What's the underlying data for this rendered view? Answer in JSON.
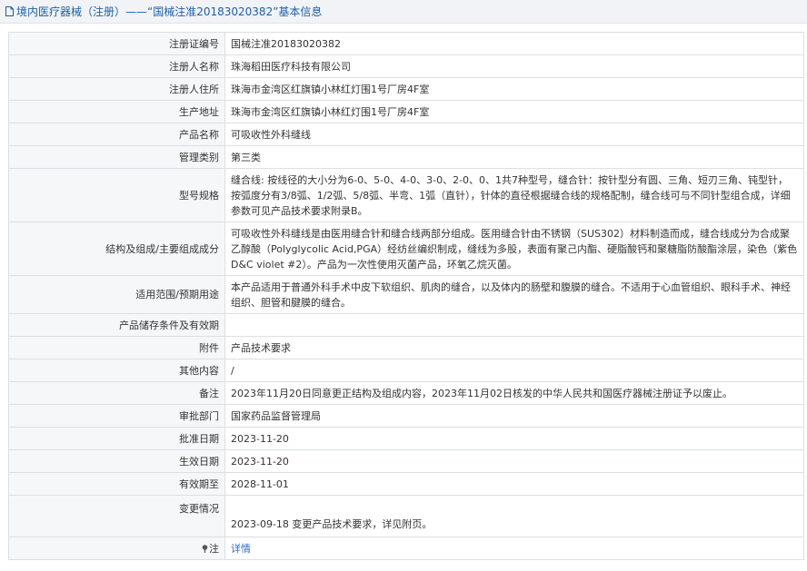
{
  "header": {
    "title": "境内医疗器械（注册）——“国械注准20183020382”基本信息"
  },
  "rows": [
    {
      "label": "注册证编号",
      "value": "国械注准20183020382"
    },
    {
      "label": "注册人名称",
      "value": "珠海稻田医疗科技有限公司"
    },
    {
      "label": "注册人住所",
      "value": "珠海市金湾区红旗镇小林红灯围1号厂房4F室"
    },
    {
      "label": "生产地址",
      "value": "珠海市金湾区红旗镇小林红灯围1号厂房4F室"
    },
    {
      "label": "产品名称",
      "value": "可吸收性外科缝线"
    },
    {
      "label": "管理类别",
      "value": "第三类"
    },
    {
      "label": "型号规格",
      "value": "缝合线: 按线径的大小分为6-0、5-0、4-0、3-0、2-0、0、1共7种型号，缝合针：按针型分有圆、三角、短刃三角、钝型针，按弧度分有3/8弧、1/2弧、5/8弧、半弯、1弧（直针），针体的直径根据缝合线的规格配制，缝合线可与不同针型组合成，详细参数可见产品技术要求附录B。"
    },
    {
      "label": "结构及组成/主要组成成分",
      "value": "可吸收性外科缝线是由医用缝合针和缝合线两部分组成。医用缝合针由不锈钢（SUS302）材料制造而成，缝合线成分为合成聚乙醇酸（Polyglycolic Acid,PGA）经纺丝编织制成，缝线为多股，表面有聚己内酯、硬脂酸钙和聚糖脂防酸酯涂层，染色（紫色D&C violet #2）。产品为一次性使用灭菌产品，环氧乙烷灭菌。"
    },
    {
      "label": "适用范围/预期用途",
      "value": "本产品适用于普通外科手术中皮下软组织、肌肉的缝合，以及体内的肠壁和腹膜的缝合。不适用于心血管组织、眼科手术、神经组织、胆管和腱膜的缝合。"
    },
    {
      "label": "产品储存条件及有效期",
      "value": ""
    },
    {
      "label": "附件",
      "value": "产品技术要求"
    },
    {
      "label": "其他内容",
      "value": "/"
    },
    {
      "label": "备注",
      "value": "2023年11月20日同意更正结构及组成内容，2023年11月02日核发的中华人民共和国医疗器械注册证予以废止。"
    },
    {
      "label": "审批部门",
      "value": "国家药品监督管理局"
    },
    {
      "label": "批准日期",
      "value": "2023-11-20"
    },
    {
      "label": "生效日期",
      "value": "2023-11-20"
    },
    {
      "label": "有效期至",
      "value": "2028-11-01"
    },
    {
      "label": "变更情况",
      "value": "2023-09-18 变更产品技术要求，详见附页。"
    }
  ],
  "note_row": {
    "label": "注",
    "link": "详情"
  },
  "colors": {
    "header_text": "#1e5fa8",
    "link": "#2b6cc4",
    "label_bg": "#f6f7f9",
    "border": "#dcdfe4"
  }
}
